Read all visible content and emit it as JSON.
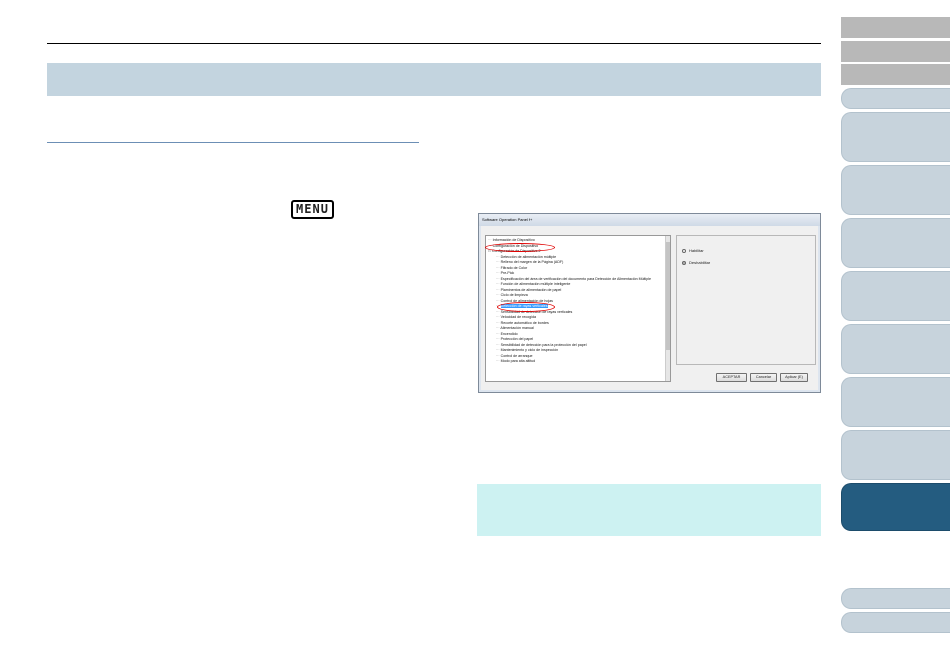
{
  "menu_key_label": "MENU",
  "window": {
    "title": "Software Operation Panel f+",
    "tree_items": [
      {
        "label": "Información de Dispositivo",
        "prefix": "···"
      },
      {
        "label": "Configuración de Dispositivo",
        "prefix": "···"
      },
      {
        "label": "Configuración de Dispositivo 2",
        "prefix": "⊟"
      },
      {
        "label": "Detección de alimentación múltiple",
        "prefix": "  ···"
      },
      {
        "label": "Relleno del margen de la Página (ADF)",
        "prefix": "  ···"
      },
      {
        "label": "Filtrado de Color",
        "prefix": "  ···"
      },
      {
        "label": "Pre-Pick",
        "prefix": "  ···"
      },
      {
        "label": "Especificación del área de verificación del documento para Detección de Alimentación Múltiple",
        "prefix": "  ···"
      },
      {
        "label": "Función de alimentación múltiple inteligente",
        "prefix": "  ···"
      },
      {
        "label": "Plaminentos de alimentación de papel",
        "prefix": "  ···"
      },
      {
        "label": "Ciclo de limpieza",
        "prefix": "  ···"
      },
      {
        "label": "Control de alimentación de hojas",
        "prefix": "  ···"
      },
      {
        "label": "Detección de rayas verticales",
        "prefix": "  ···",
        "selected": true
      },
      {
        "label": "Sensibilidad de detección de rayas verticales",
        "prefix": "  ···"
      },
      {
        "label": "Velocidad de recogida",
        "prefix": "  ···"
      },
      {
        "label": "Recorte automático de bordes",
        "prefix": "  ···"
      },
      {
        "label": "Alimentación manual",
        "prefix": "  ···"
      },
      {
        "label": "Encendido",
        "prefix": "  ···"
      },
      {
        "label": "Protección del papel",
        "prefix": "  ···"
      },
      {
        "label": "Sensibilidad de detección para la protección del papel",
        "prefix": "  ···"
      },
      {
        "label": "Mantenimiento y ciclo de inspección",
        "prefix": "  ···"
      },
      {
        "label": "Control de arranque",
        "prefix": "  ···"
      },
      {
        "label": "Modo para alta altitud",
        "prefix": "  ···"
      }
    ],
    "options": [
      {
        "label": "Habilitar",
        "selected": false
      },
      {
        "label": "Deshabilitar",
        "selected": true
      }
    ],
    "buttons": {
      "ok": "ACEPTAR",
      "cancel": "Cancelar",
      "apply": "Aplicar (E)"
    }
  }
}
